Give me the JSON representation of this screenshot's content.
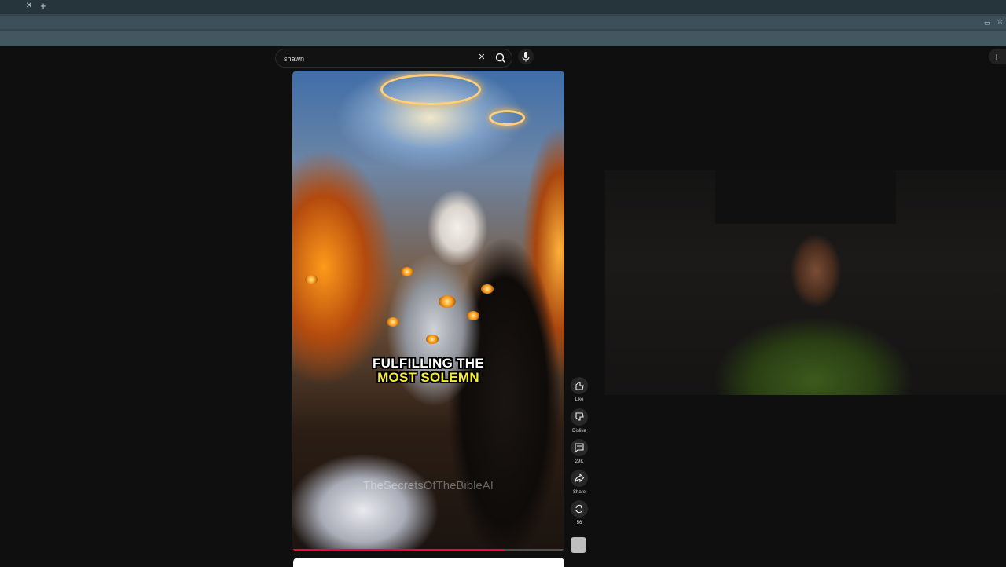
{
  "browser": {
    "tab_close_icon": "close-icon",
    "new_tab_icon": "plus-icon",
    "toolbar_icons": [
      "cast-icon",
      "star-icon"
    ]
  },
  "search": {
    "value": "shawn",
    "clear_icon": "close-icon",
    "search_icon": "search-icon",
    "mic_icon": "mic-icon"
  },
  "create_button": {
    "icon": "plus-icon"
  },
  "short": {
    "caption_line1": "FULFILLING THE",
    "caption_line2": "MOST SOLEMN",
    "watermark": "TheSecretsOfTheBibleAI",
    "progress_fraction": 0.78,
    "colors": {
      "caption_white": "#ffffff",
      "caption_yellow": "#f7ef2a",
      "progress": "#ff0033"
    }
  },
  "actions": [
    {
      "icon": "thumbs-up-icon",
      "label": "Like"
    },
    {
      "icon": "thumbs-down-icon",
      "label": "Dislike"
    },
    {
      "icon": "comment-icon",
      "label": "29K"
    },
    {
      "icon": "share-icon",
      "label": "Share"
    },
    {
      "icon": "remix-icon",
      "label": "56"
    }
  ]
}
